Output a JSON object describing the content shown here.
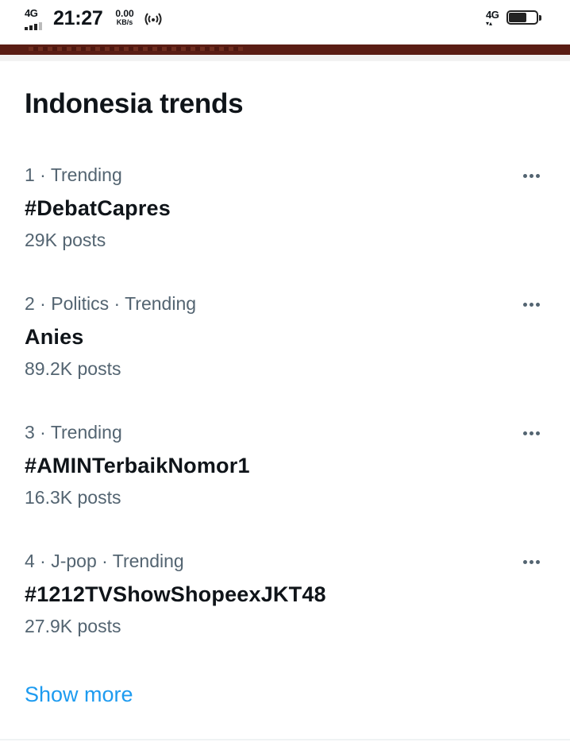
{
  "status_bar": {
    "network_left": "4G",
    "time": "21:27",
    "speed_value": "0.00",
    "speed_unit": "KB/s",
    "hotspot_icon": "hotspot-icon",
    "network_right": "4G",
    "battery_percent": 70
  },
  "trends": {
    "title": "Indonesia trends",
    "items": [
      {
        "meta": "1 · Trending",
        "name": "#DebatCapres",
        "posts": "29K posts"
      },
      {
        "meta": "2 · Politics · Trending",
        "name": "Anies",
        "posts": "89.2K posts"
      },
      {
        "meta": "3 · Trending",
        "name": "#AMINTerbaikNomor1",
        "posts": "16.3K posts"
      },
      {
        "meta": "4 · J-pop · Trending",
        "name": "#1212TVShowShopeexJKT48",
        "posts": "27.9K posts"
      }
    ],
    "show_more": "Show more"
  },
  "colors": {
    "text_primary": "#0f1419",
    "text_secondary": "#536471",
    "link": "#1d9bf0",
    "banner": "#5a1d14"
  }
}
